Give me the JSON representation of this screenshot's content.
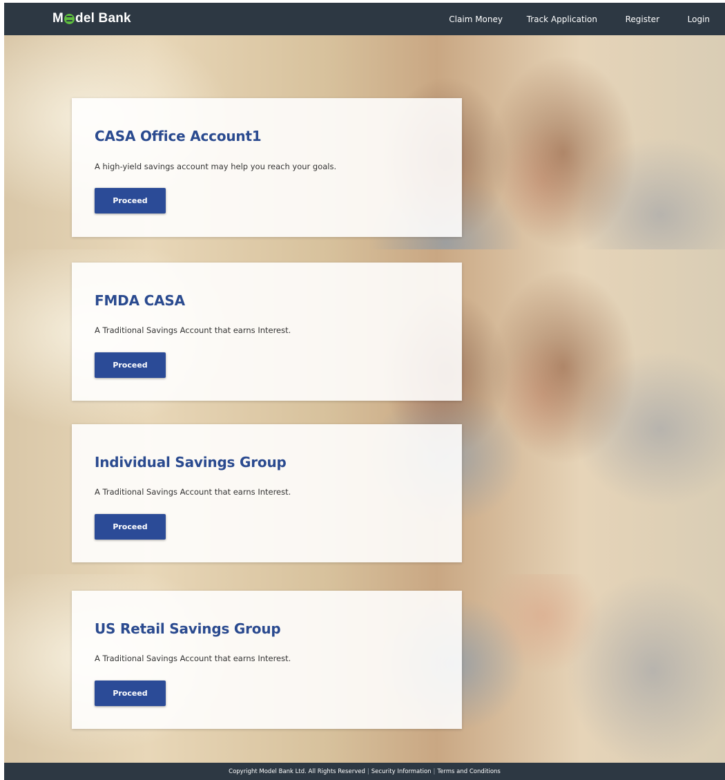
{
  "header": {
    "logo_prefix": "M",
    "logo_suffix": "del Bank",
    "logo_icon": "logo-o-icon",
    "nav": {
      "claim_money": "Claim Money",
      "track_application": "Track Application",
      "register": "Register",
      "login": "Login"
    }
  },
  "products": [
    {
      "title": "CASA Office Account1",
      "description": "A high-yield savings account may help you reach your goals.",
      "button": "Proceed"
    },
    {
      "title": "FMDA CASA",
      "description": "A Traditional Savings Account that earns Interest.",
      "button": "Proceed"
    },
    {
      "title": "Individual Savings Group",
      "description": "A Traditional Savings Account that earns Interest.",
      "button": "Proceed"
    },
    {
      "title": "US Retail Savings Group",
      "description": "A Traditional Savings Account that earns Interest.",
      "button": "Proceed"
    }
  ],
  "footer": {
    "copyright": "Copyright Model Bank Ltd. All Rights Reserved",
    "separator": "|",
    "security": "Security Information",
    "terms": "Terms and Conditions"
  },
  "colors": {
    "header_bg": "#2d3843",
    "title_blue": "#2a4a8f",
    "button_blue": "#2b4b97",
    "logo_green": "#5ebd3e"
  }
}
